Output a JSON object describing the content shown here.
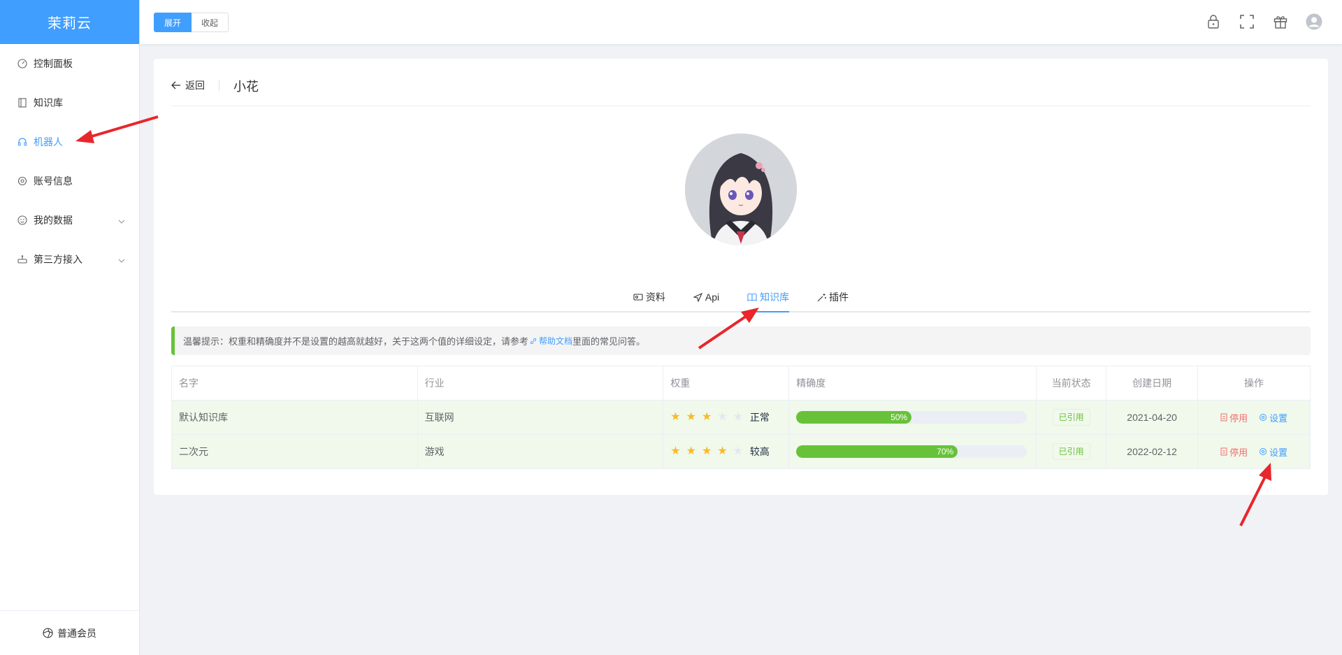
{
  "sidebar": {
    "logo": "茉莉云",
    "items": [
      {
        "label": "控制面板"
      },
      {
        "label": "知识库"
      },
      {
        "label": "机器人"
      },
      {
        "label": "账号信息"
      },
      {
        "label": "我的数据"
      },
      {
        "label": "第三方接入"
      }
    ],
    "footer": "普通会员"
  },
  "header": {
    "expand": "展开",
    "collapse": "收起"
  },
  "page": {
    "back": "返回",
    "title": "小花"
  },
  "tabs": [
    {
      "label": "资料"
    },
    {
      "label": "Api"
    },
    {
      "label": "知识库"
    },
    {
      "label": "插件"
    }
  ],
  "alert": {
    "text": "温馨提示：权重和精确度并不是设置的越高就越好，关于这两个值的详细设定，请参考",
    "link": "帮助文档",
    "suffix": "里面的常见问答。"
  },
  "table": {
    "headers": [
      "名字",
      "行业",
      "权重",
      "精确度",
      "当前状态",
      "创建日期",
      "操作"
    ],
    "rows": [
      {
        "name": "默认知识库",
        "industry": "互联网",
        "weight": 3,
        "weight_text": "正常",
        "accuracy": "50%",
        "status": "已引用",
        "date": "2021-04-20",
        "disable": "停用",
        "settings": "设置"
      },
      {
        "name": "二次元",
        "industry": "游戏",
        "weight": 4,
        "weight_text": "较高",
        "accuracy": "70%",
        "status": "已引用",
        "date": "2022-02-12",
        "disable": "停用",
        "settings": "设置"
      }
    ]
  },
  "colors": {
    "primary": "#409eff",
    "success": "#67c23a",
    "danger": "#f56c6c",
    "annotation": "#e8262b"
  }
}
